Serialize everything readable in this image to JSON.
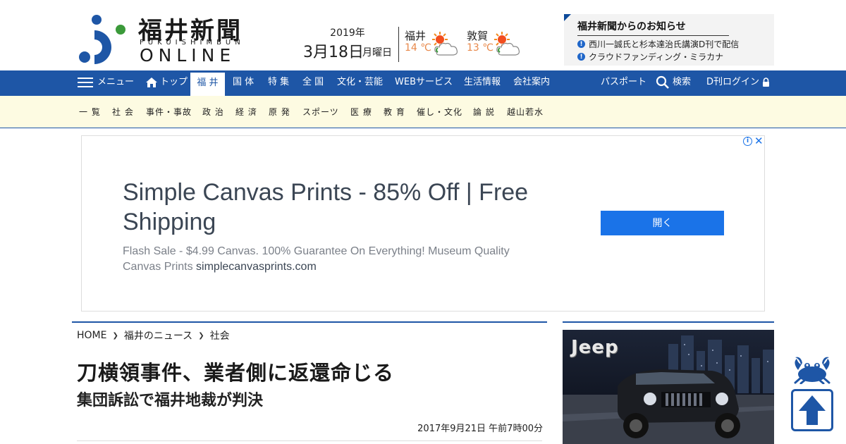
{
  "brand": {
    "title": "福井新聞",
    "sub": "FUKUISHIMBUN",
    "online": "ONLINE"
  },
  "date": {
    "year": "2019年",
    "month_day": "3月18日",
    "weekday": "月曜日"
  },
  "weather": [
    {
      "city": "福井",
      "temp": "14 ℃",
      "icon": "sunny-then-cloudy-icon"
    },
    {
      "city": "敦賀",
      "temp": "13 ℃",
      "icon": "sunny-then-cloudy-icon"
    }
  ],
  "notice": {
    "title": "福井新聞からのお知らせ",
    "items": [
      "西川一誠氏と杉本達治氏講演D刊で配信",
      "クラウドファンディング・ミラカナ"
    ]
  },
  "nav": {
    "menu_label": "メニュー",
    "top_label": "トップ",
    "items": [
      "福 井",
      "国 体",
      "特 集",
      "全 国",
      "文化・芸能",
      "WEBサービス",
      "生活情報",
      "会社案内"
    ],
    "passport": "パスポート",
    "search": "検索",
    "login": "D刊ログイン"
  },
  "subnav": {
    "items": [
      "一 覧",
      "社 会",
      "事件・事故",
      "政 治",
      "経 済",
      "原 発",
      "スポーツ",
      "医 療",
      "教 育",
      "催し・文化",
      "論 説",
      "越山若水"
    ]
  },
  "ad": {
    "headline": "Simple Canvas Prints - 85% Off | Free Shipping",
    "description": "Flash Sale - $4.99 Canvas. 100% Guarantee On Everything! Museum Quality Canvas Prints",
    "domain": "simplecanvasprints.com",
    "button": "開く"
  },
  "article": {
    "breadcrumb": [
      "HOME",
      "福井のニュース",
      "社会"
    ],
    "headline": "刀横領事件、業者側に返還命じる",
    "subhead": "集団訴訟で福井地裁が判決",
    "date": "2017年9月21日 午前7時00分"
  },
  "sidebar_ad": {
    "brand": "Jeep"
  },
  "colors": {
    "nav_blue": "#1e56a6",
    "subnav_bg": "#fdfbe2",
    "temp_orange": "#e8884a",
    "ad_button": "#1a73e8"
  }
}
